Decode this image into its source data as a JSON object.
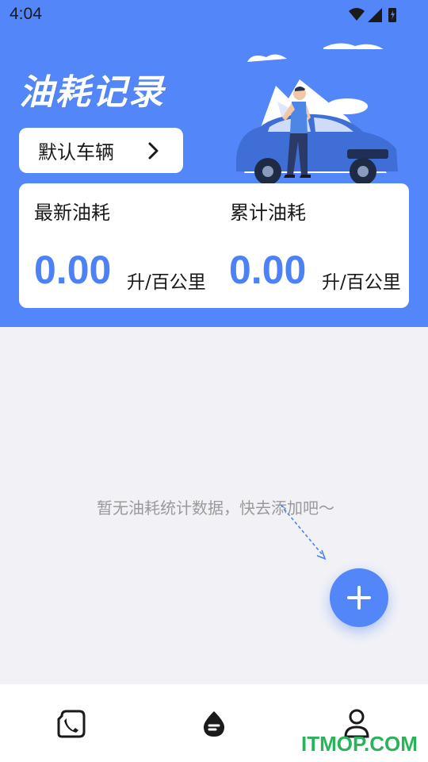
{
  "status_bar": {
    "time": "4:04"
  },
  "header": {
    "title": "油耗记录",
    "vehicle_button_label": "默认车辆"
  },
  "stats": {
    "latest": {
      "label": "最新油耗",
      "value": "0.00",
      "unit": "升/百公里"
    },
    "total": {
      "label": "累计油耗",
      "value": "0.00",
      "unit": "升/百公里"
    }
  },
  "empty_state": {
    "text": "暂无油耗统计数据，快去添加吧～"
  },
  "bottom_nav": {
    "items": [
      {
        "icon": "phone-icon"
      },
      {
        "icon": "fuel-drop-icon"
      },
      {
        "icon": "user-icon"
      }
    ]
  },
  "watermark": "ITMOP.COM",
  "colors": {
    "primary": "#5386f8",
    "value_blue": "#4c82f5",
    "background": "#f2f2f6"
  }
}
